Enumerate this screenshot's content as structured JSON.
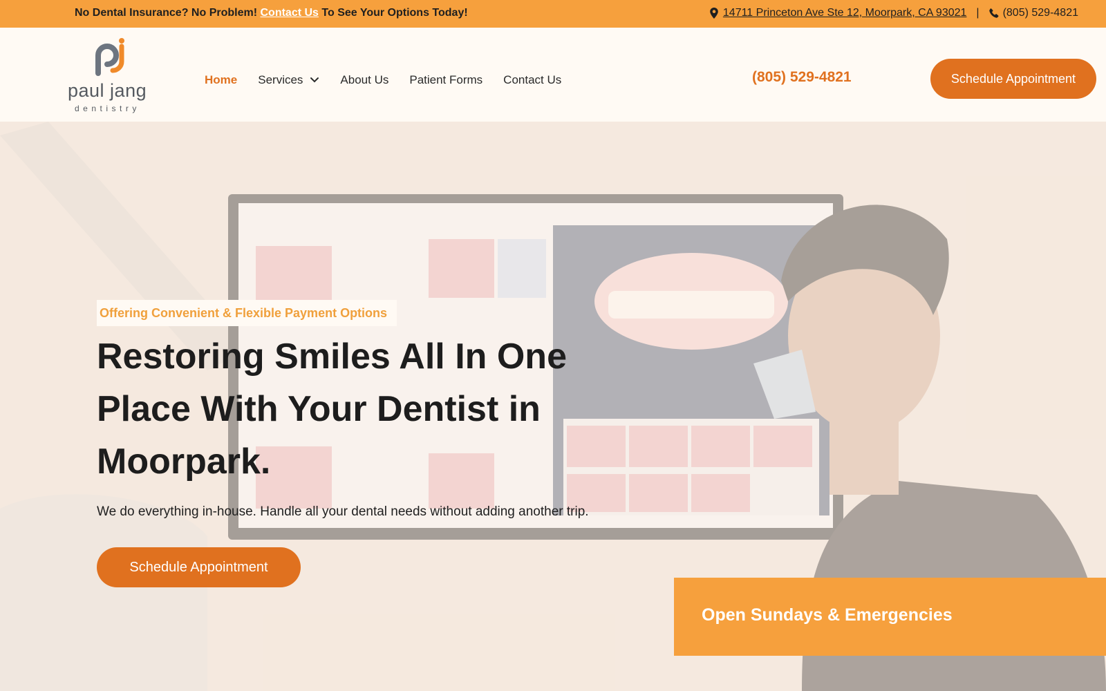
{
  "topbar": {
    "promo_before": "No Dental Insurance? No Problem!",
    "promo_link": "Contact Us",
    "promo_after": "To See Your Options Today!",
    "address": "14711 Princeton Ave Ste 12, Moorpark, CA 93021",
    "separator": "|",
    "phone": "(805) 529-4821",
    "icons": [
      "map-pin-icon",
      "phone-icon"
    ]
  },
  "logo": {
    "name": "paul jang",
    "tagline": "dentistry"
  },
  "nav": {
    "items": [
      {
        "label": "Home",
        "active": true
      },
      {
        "label": "Services",
        "has_dropdown": true
      },
      {
        "label": "About Us"
      },
      {
        "label": "Patient Forms"
      },
      {
        "label": "Contact Us"
      }
    ]
  },
  "header": {
    "phone": "(805) 529-4821",
    "cta_label": "Schedule Appointment"
  },
  "hero": {
    "eyebrow": "Offering Convenient & Flexible Payment Options",
    "title": "Restoring Smiles All In One Place With Your Dentist in Moorpark.",
    "subtitle": "We do everything in-house. Handle all your dental needs without adding another trip.",
    "cta_label": "Schedule Appointment",
    "badge": "Open Sundays & Emergencies"
  },
  "colors": {
    "accent_orange": "#e0711f",
    "light_orange": "#f6a03d",
    "header_bg": "#fffaf4",
    "text_dark": "#1d1d1d"
  }
}
